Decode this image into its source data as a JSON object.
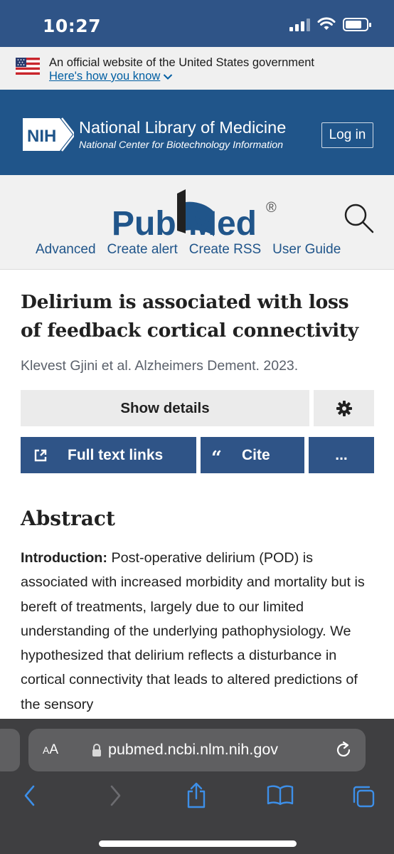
{
  "status_bar": {
    "time": "10:27"
  },
  "gov_banner": {
    "text": "An official website of the United States government",
    "link": "Here's how you know"
  },
  "nlm": {
    "logo_text": "NIH",
    "title": "National Library of Medicine",
    "subtitle": "National Center for Biotechnology Information",
    "login": "Log in"
  },
  "pubmed": {
    "logo_left": "Pub",
    "logo_right": "Med",
    "registered": "®",
    "links": [
      "Advanced",
      "Create alert",
      "Create RSS",
      "User Guide"
    ]
  },
  "article": {
    "title_line1": "Delirium is associated with loss",
    "title_line2": "of feedback cortical connectivity",
    "meta": "Klevest Gjini et al. Alzheimers Dement. 2023.",
    "show_details": "Show details",
    "full_text": "Full text links",
    "cite": "Cite",
    "more": "...",
    "abstract_heading": "Abstract",
    "abstract_label": "Introduction:",
    "abstract_body": " Post-operative delirium (POD) is associated with increased morbidity and mortality but is bereft of treatments, largely due to our limited understanding of the underlying pathophysiology. We hypothesized that delirium reflects a disturbance in cortical connectivity that leads to altered predictions of the sensory"
  },
  "safari": {
    "aa_small": "A",
    "aa_large": "A",
    "url": "pubmed.ncbi.nlm.nih.gov"
  },
  "colors": {
    "nih_blue": "#20558a",
    "status_blue": "#2f5487",
    "link_blue": "#005ea2"
  }
}
